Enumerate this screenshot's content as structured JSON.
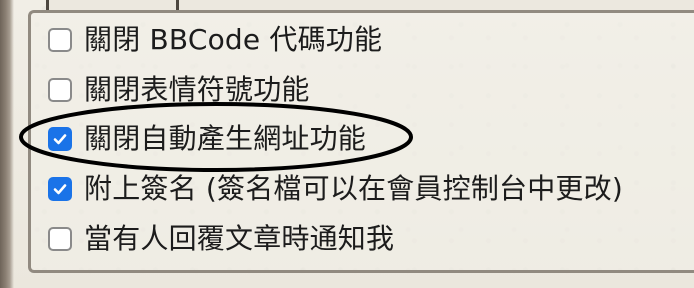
{
  "options": [
    {
      "label": "關閉 BBCode 代碼功能",
      "checked": false,
      "icon": "checkbox-unchecked"
    },
    {
      "label": "關閉表情符號功能",
      "checked": false,
      "icon": "checkbox-unchecked"
    },
    {
      "label": "關閉自動產生網址功能",
      "checked": true,
      "icon": "checkbox-checked"
    },
    {
      "label": "附上簽名 (簽名檔可以在會員控制台中更改)",
      "checked": true,
      "icon": "checkbox-checked"
    },
    {
      "label": "當有人回覆文章時通知我",
      "checked": false,
      "icon": "checkbox-unchecked"
    }
  ],
  "colors": {
    "checkbox_checked": "#1a73e8",
    "annotation_ellipse": "#000000"
  }
}
